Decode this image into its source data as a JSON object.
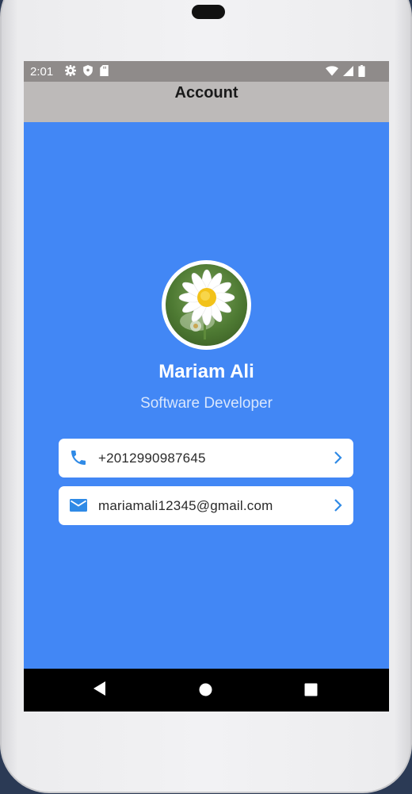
{
  "status_bar": {
    "time": "2:01",
    "left_icons": [
      "settings-icon",
      "shield-icon",
      "sd-card-icon"
    ],
    "right_icons": [
      "wifi-icon",
      "signal-icon",
      "battery-icon"
    ]
  },
  "app_bar": {
    "title": "Account"
  },
  "profile": {
    "avatar_icon": "daisy-flower-photo",
    "name": "Mariam Ali",
    "role": "Software Developer"
  },
  "contacts": [
    {
      "icon": "phone-icon",
      "value": "+2012990987645"
    },
    {
      "icon": "email-icon",
      "value": "mariamali12345@gmail.com"
    }
  ],
  "nav_bar": {
    "buttons": [
      "back-icon",
      "home-icon",
      "recents-icon"
    ]
  },
  "colors": {
    "screen_background": "#4287f5",
    "app_bar": "#bdbab9",
    "status_bar": "#8f8b8a",
    "icon_accent": "#2f8ae6",
    "card": "#ffffff"
  }
}
